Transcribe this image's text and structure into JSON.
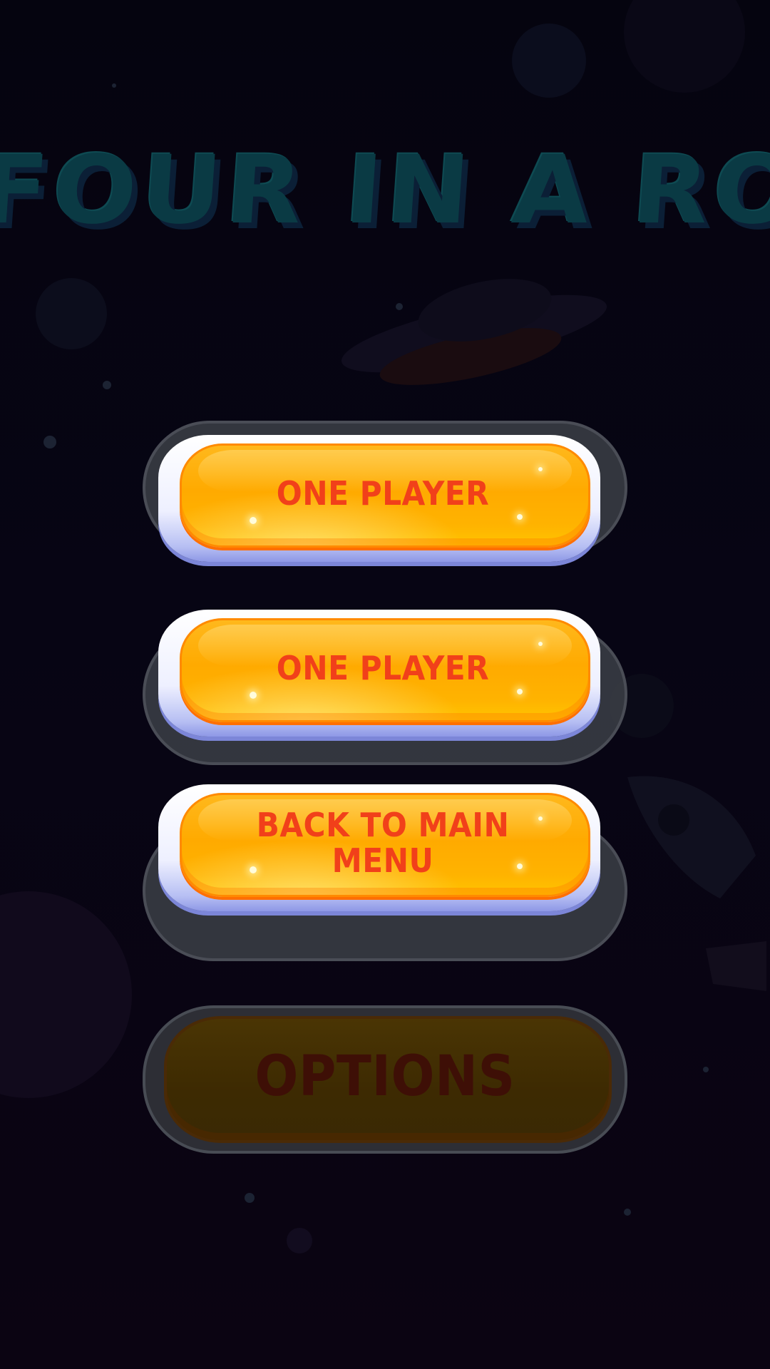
{
  "title": "FOUR IN A ROW",
  "buttons": [
    {
      "label": "ONE PLAYER"
    },
    {
      "label": "ONE PLAYER"
    },
    {
      "label": "BACK TO MAIN MENU"
    },
    {
      "label": "OPTIONS"
    }
  ],
  "colors": {
    "background": "#06040f",
    "title": "#0a3a44",
    "button_face": "#ffaa00",
    "button_frame": "#eef0ff",
    "button_text": "#f1401a",
    "dimmed_face": "#3d2a02",
    "dimmed_text": "#3e0f06"
  },
  "decor": [
    "planet",
    "ufo",
    "rocket",
    "stars"
  ]
}
